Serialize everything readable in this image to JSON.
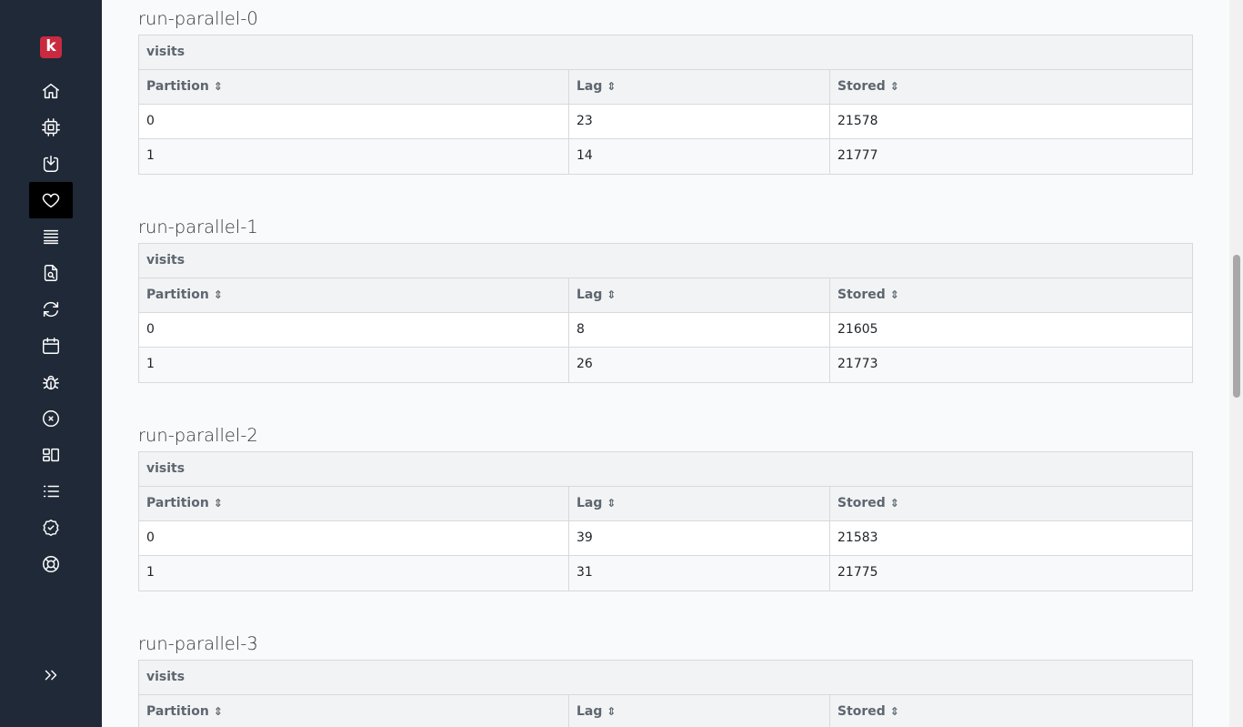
{
  "sidebar": {
    "logo_letter": "k",
    "brand_color": "#c92a3f",
    "items": [
      {
        "name": "home",
        "icon": "home-icon"
      },
      {
        "name": "cluster",
        "icon": "cpu-icon"
      },
      {
        "name": "flows",
        "icon": "download-icon"
      },
      {
        "name": "health",
        "icon": "heart-icon",
        "active": true
      },
      {
        "name": "topics",
        "icon": "layers-icon"
      },
      {
        "name": "schemas",
        "icon": "file-search-icon"
      },
      {
        "name": "connect",
        "icon": "refresh-icon"
      },
      {
        "name": "calendar",
        "icon": "calendar-icon"
      },
      {
        "name": "debug",
        "icon": "bug-icon"
      },
      {
        "name": "errors",
        "icon": "x-circle-icon"
      },
      {
        "name": "dashboards",
        "icon": "layout-icon"
      },
      {
        "name": "list",
        "icon": "list-icon"
      },
      {
        "name": "tests",
        "icon": "check-circle-icon"
      },
      {
        "name": "support",
        "icon": "lifebuoy-icon"
      }
    ],
    "expand_icon": "chevrons-right-icon"
  },
  "sort_glyph": "⇕",
  "sections": [
    {
      "title": "run-parallel-0",
      "caption": "visits",
      "headers": [
        "Partition",
        "Lag",
        "Stored"
      ],
      "rows": [
        [
          "0",
          "23",
          "21578"
        ],
        [
          "1",
          "14",
          "21777"
        ]
      ]
    },
    {
      "title": "run-parallel-1",
      "caption": "visits",
      "headers": [
        "Partition",
        "Lag",
        "Stored"
      ],
      "rows": [
        [
          "0",
          "8",
          "21605"
        ],
        [
          "1",
          "26",
          "21773"
        ]
      ]
    },
    {
      "title": "run-parallel-2",
      "caption": "visits",
      "headers": [
        "Partition",
        "Lag",
        "Stored"
      ],
      "rows": [
        [
          "0",
          "39",
          "21583"
        ],
        [
          "1",
          "31",
          "21775"
        ]
      ]
    },
    {
      "title": "run-parallel-3",
      "caption": "visits",
      "headers": [
        "Partition",
        "Lag",
        "Stored"
      ],
      "rows": []
    }
  ]
}
